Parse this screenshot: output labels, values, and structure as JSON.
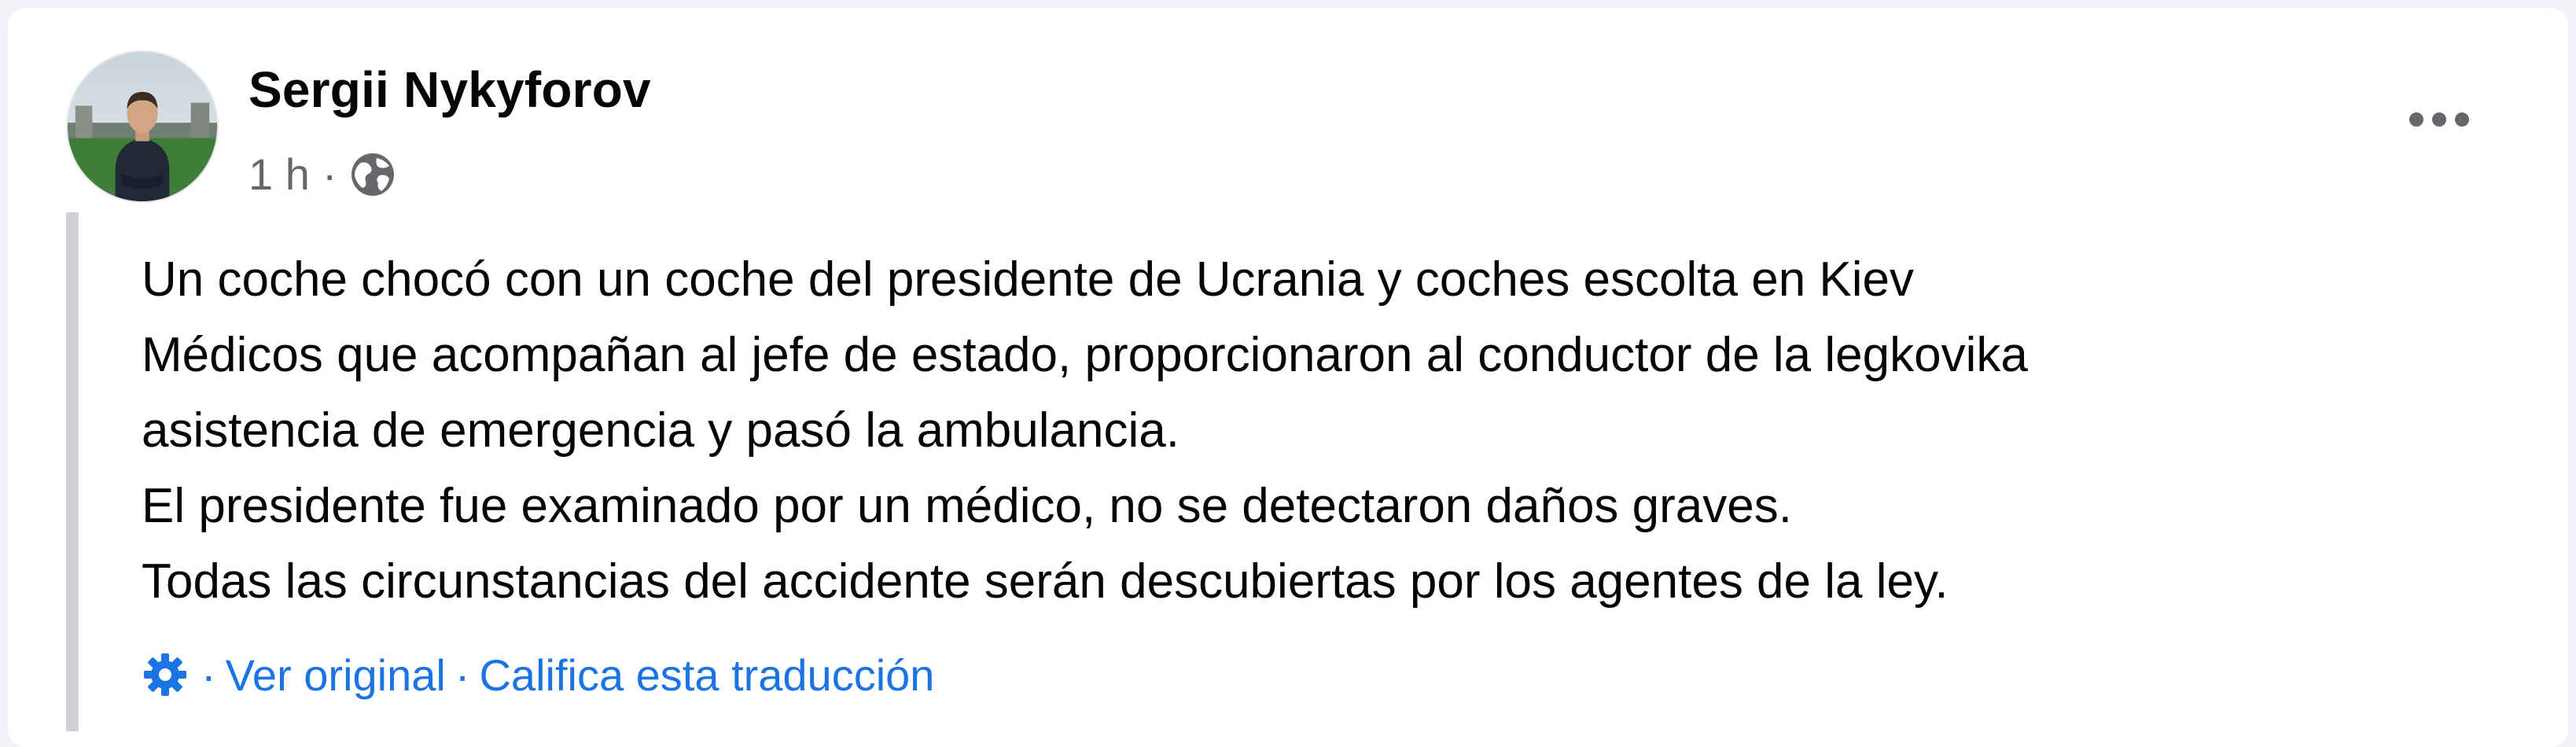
{
  "post": {
    "author": {
      "name": "Sergii Nykyforov"
    },
    "meta": {
      "time": "1 h",
      "separator": "·",
      "audience_icon": "globe-icon"
    },
    "more_icon": "more-dots-icon",
    "body_lines": [
      "Un coche chocó con un coche del presidente de Ucrania y coches escolta en Kiev",
      "Médicos que acompañan al jefe de estado, proporcionaron al conductor de la legkovika",
      "asistencia de emergencia y pasó la ambulancia.",
      "El presidente fue examinado por un médico, no se detectaron daños graves.",
      "Todas las circunstancias del accidente serán descubiertas por los agentes de la ley."
    ],
    "translation": {
      "settings_icon": "gear-icon",
      "separator": "·",
      "see_original": "Ver original",
      "rate_translation": "Califica esta traducción"
    }
  },
  "colors": {
    "link": "#1b74e4",
    "secondary_text": "#65676b",
    "quote_bar": "#d0d1d6",
    "background": "#f0f2f5",
    "card": "#ffffff"
  }
}
